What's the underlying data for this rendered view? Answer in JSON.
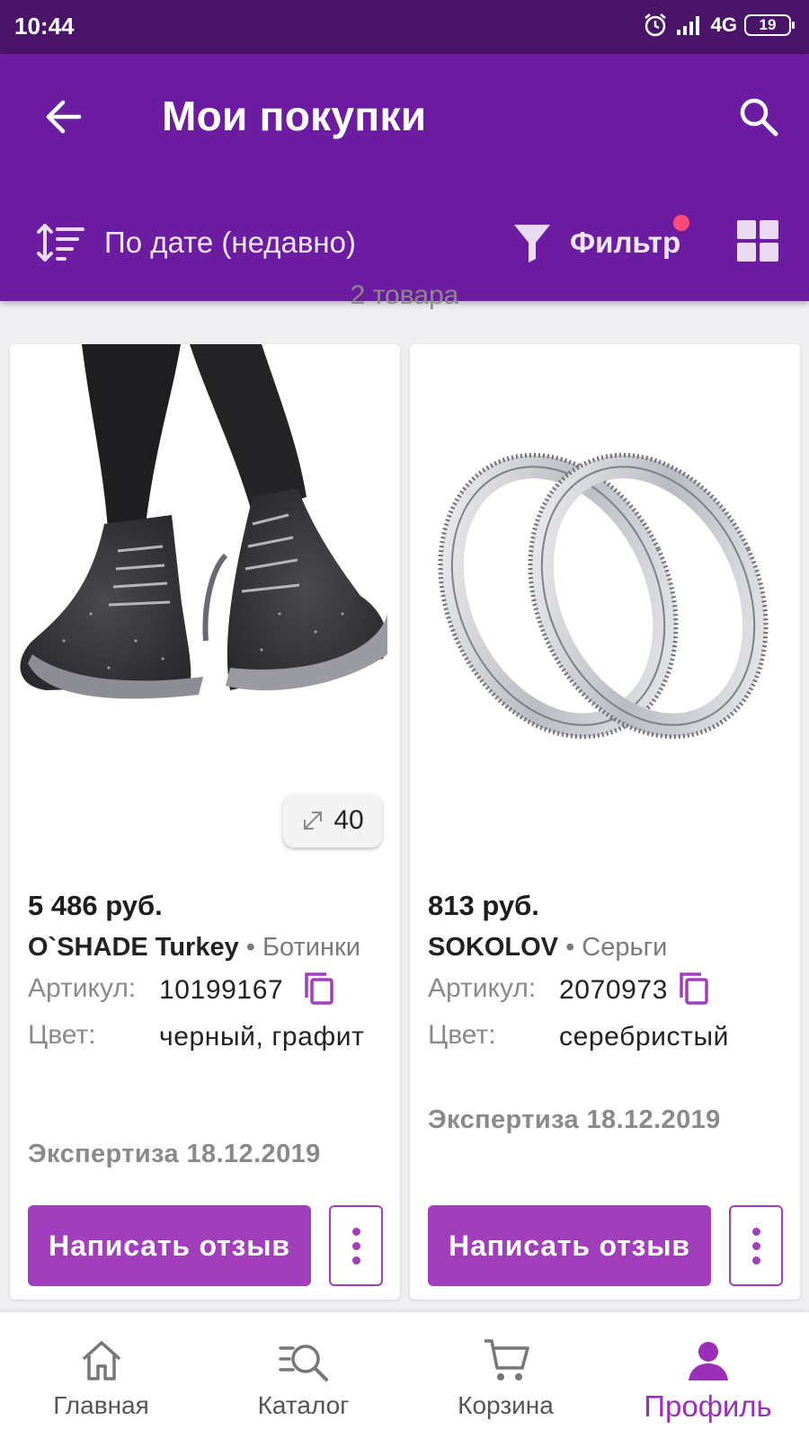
{
  "status": {
    "time": "10:44",
    "network": "4G",
    "battery": "19"
  },
  "header": {
    "title": "Мои покупки",
    "sort_label": "По дате (недавно)",
    "filter_label": "Фильтр"
  },
  "count_text": "2 товара",
  "products": [
    {
      "price": "5 486 руб.",
      "brand": "O`SHADE Turkey",
      "category": "• Ботинки",
      "article_label": "Артикул:",
      "article": "10199167",
      "color_label": "Цвет:",
      "color_value": "черный, графит",
      "expertise": "Экспертиза 18.12.2019",
      "size": "40",
      "review_button": "Написать отзыв"
    },
    {
      "price": "813 руб.",
      "brand": "SOKOLOV",
      "category": "• Серьги",
      "article_label": "Артикул:",
      "article": "2070973",
      "color_label": "Цвет:",
      "color_value": "серебристый",
      "expertise": "Экспертиза 18.12.2019",
      "review_button": "Написать отзыв"
    }
  ],
  "nav": {
    "home": "Главная",
    "catalog": "Каталог",
    "cart": "Корзина",
    "profile": "Профиль"
  },
  "colors": {
    "primary": "#6c1ca0",
    "status_bar": "#4a1468",
    "accent": "#a13ebc",
    "badge_dot": "#ff4a7a"
  }
}
